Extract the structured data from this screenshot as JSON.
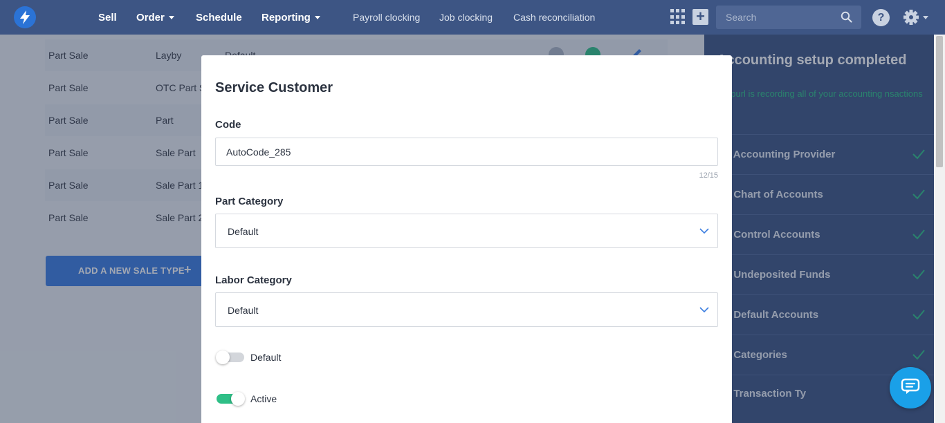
{
  "nav": {
    "main_items": [
      {
        "label": "Sell",
        "has_caret": false
      },
      {
        "label": "Order",
        "has_caret": true
      },
      {
        "label": "Schedule",
        "has_caret": false
      },
      {
        "label": "Reporting",
        "has_caret": true
      }
    ],
    "sub_items": [
      "Payroll clocking",
      "Job clocking",
      "Cash reconciliation"
    ],
    "search_placeholder": "Search",
    "help_label": "?"
  },
  "table": {
    "rows": [
      {
        "type": "Part Sale",
        "name": "Layby",
        "category": "Default"
      },
      {
        "type": "Part Sale",
        "name": "OTC Part Sa",
        "category": ""
      },
      {
        "type": "Part Sale",
        "name": "Part",
        "category": ""
      },
      {
        "type": "Part Sale",
        "name": "Sale Part",
        "category": ""
      },
      {
        "type": "Part Sale",
        "name": "Sale Part 1",
        "category": ""
      },
      {
        "type": "Part Sale",
        "name": "Sale Part 2",
        "category": ""
      }
    ],
    "add_button_label": "ADD A NEW SALE TYPE"
  },
  "setup_panel": {
    "title": "Accounting setup completed",
    "subtitle": "ackpurl is recording all of your accounting nsactions",
    "steps": [
      ". Accounting Provider",
      ". Chart of Accounts",
      ". Control Accounts",
      ". Undeposited Funds",
      ". Default Accounts",
      ". Categories",
      ". Transaction Ty"
    ]
  },
  "modal": {
    "title": "Service Customer",
    "code_label": "Code",
    "code_value": "AutoCode_285",
    "code_counter": "12/15",
    "part_category_label": "Part Category",
    "part_category_value": "Default",
    "labor_category_label": "Labor Category",
    "labor_category_value": "Default",
    "default_toggle_label": "Default",
    "default_toggle_on": false,
    "active_toggle_label": "Active",
    "active_toggle_on": true
  },
  "colors": {
    "nav_bg": "#3d5584",
    "accent_blue": "#3b7de0",
    "toggle_on": "#2fbf87",
    "chat_bubble": "#1aa0e8"
  }
}
